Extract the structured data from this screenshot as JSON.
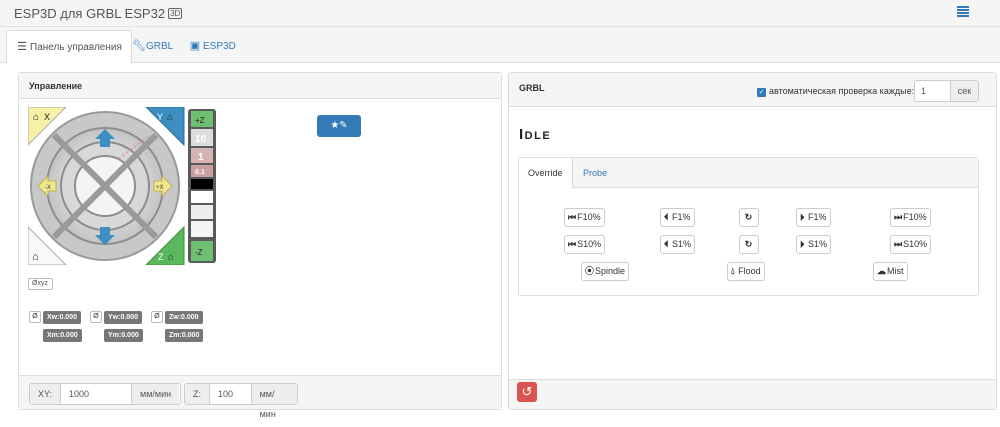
{
  "app": {
    "title": "ESP3D для GRBL ESP32",
    "title_icon": "3D"
  },
  "tabs": [
    {
      "label": "Панель управления",
      "icon": "dashboard-icon"
    },
    {
      "label": "GRBL",
      "icon": "wrench-icon"
    },
    {
      "label": "ESP3D",
      "icon": "esp3d-icon"
    }
  ],
  "control": {
    "title": "Управление",
    "jog": {
      "home_x": "X",
      "home_y": "Y",
      "home_z": "Z",
      "plus_z": "+Z",
      "minus_z": "-Z",
      "minus_x": "-X",
      "plus_x": "+X",
      "minus_y": "-Y",
      "steps": [
        "10",
        "1",
        "0.1"
      ]
    },
    "reset_xyz": "Øxyz",
    "zero_symbol": "Ø",
    "positions": {
      "xw": "Xw:0.000",
      "yw": "Yw:0.000",
      "zw": "Zw:0.000",
      "xm": "Xm:0.000",
      "ym": "Ym:0.000",
      "zm": "Zm:0.000"
    },
    "feed": {
      "xy_label": "XY:",
      "xy_value": "1000",
      "xy_unit": "мм/мин",
      "z_label": "Z:",
      "z_value": "100",
      "z_unit": "мм/мин"
    }
  },
  "grbl": {
    "title": "GRBL",
    "autocheck_label": "автоматическая проверка каждые:",
    "autocheck_checked": true,
    "autocheck_value": "1",
    "autocheck_unit": "сек",
    "state": "Idle",
    "subtabs": [
      "Override",
      "Probe"
    ],
    "override": {
      "row1": [
        "F10%",
        "F1%",
        "",
        "F1%",
        "F10%"
      ],
      "row2": [
        "S10%",
        "S1%",
        "",
        "S1%",
        "S10%"
      ],
      "spindle": "Spindle",
      "flood": "Flood",
      "mist": "Mist"
    }
  },
  "colors": {
    "accent": "#337ab7",
    "danger": "#d9534f",
    "home_yellow": "#f7f1a8",
    "home_blue": "#3d8fc2",
    "home_green": "#5cb85c"
  }
}
